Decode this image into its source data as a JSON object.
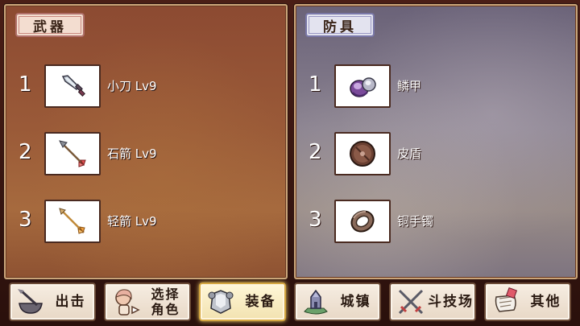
{
  "weapons": {
    "tab_label": "武器",
    "items": [
      {
        "index": "1",
        "name": "小刀 Lv9",
        "icon": "dagger-icon"
      },
      {
        "index": "2",
        "name": "石箭 Lv9",
        "icon": "stone-arrow-icon"
      },
      {
        "index": "3",
        "name": "轻箭 Lv9",
        "icon": "light-arrow-icon"
      }
    ]
  },
  "armor": {
    "tab_label": "防具",
    "items": [
      {
        "index": "1",
        "name": "鳞甲",
        "icon": "scale-armor-icon"
      },
      {
        "index": "2",
        "name": "皮盾",
        "icon": "leather-shield-icon"
      },
      {
        "index": "3",
        "name": "铜手镯",
        "icon": "copper-bracelet-icon"
      }
    ]
  },
  "nav": {
    "sortie": "出击",
    "select_line1": "选择",
    "select_line2": "角色",
    "equip": "装备",
    "town": "城镇",
    "arena": "斗技场",
    "other": "其他"
  },
  "colors": {
    "weapon_panel": "#9a5a38",
    "armor_panel": "#8a8290",
    "active_nav": "#f2e2b0"
  }
}
